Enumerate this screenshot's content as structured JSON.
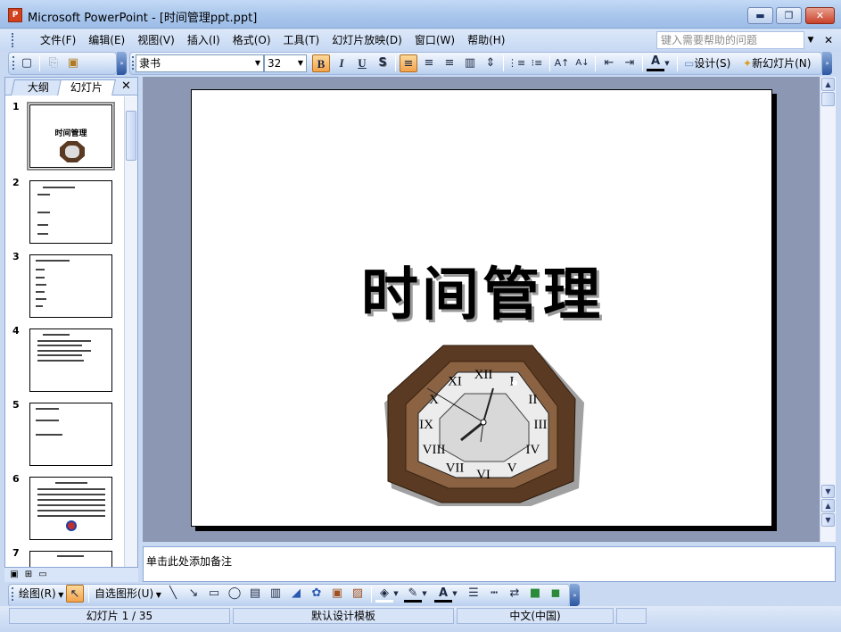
{
  "window": {
    "title": "Microsoft PowerPoint - [时间管理ppt.ppt]",
    "app_icon_text": "P",
    "min_glyph": "▬",
    "max_glyph": "❐",
    "close_glyph": "✕"
  },
  "menubar": {
    "items": [
      "文件(F)",
      "编辑(E)",
      "视图(V)",
      "插入(I)",
      "格式(O)",
      "工具(T)",
      "幻灯片放映(D)",
      "窗口(W)",
      "帮助(H)"
    ],
    "help_placeholder": "键入需要帮助的问题",
    "help_arrow": "▼",
    "close_glyph": "✕"
  },
  "toolbar": {
    "font": "隶书",
    "size": "32",
    "dropdown_arrow": "▼",
    "bold": "B",
    "italic": "I",
    "underline": "U",
    "shadow": "S",
    "align_left": "≡",
    "align_center": "≡",
    "align_right": "≡",
    "distribute": "▥",
    "column": "⇕",
    "numbering": "⋮≡",
    "bullets": "⁝≡",
    "grow": "A↑",
    "shrink": "A↓",
    "decrease_indent": "⇤",
    "increase_indent": "⇥",
    "font_color": "A",
    "design_label": "设计(S)",
    "new_slide_label": "新幻灯片(N)",
    "new_glyph": "▢",
    "copy_glyph": "⎘",
    "paste_glyph": "▣",
    "more_glyph": "»"
  },
  "left_pane": {
    "tab_outline": "大纲",
    "tab_slides": "幻灯片",
    "close_glyph": "✕",
    "slide_numbers": [
      "1",
      "2",
      "3",
      "4",
      "5",
      "6",
      "7"
    ],
    "view_normal": "▣",
    "view_sorter": "⊞",
    "view_show": "▭"
  },
  "slide": {
    "title": "时间管理",
    "clock_numerals": [
      "XII",
      "I",
      "II",
      "III",
      "IV",
      "V",
      "VI",
      "VII",
      "VIII",
      "IX",
      "X",
      "XI"
    ]
  },
  "notes": {
    "placeholder": "单击此处添加备注"
  },
  "drawbar": {
    "draw_label": "绘图(R)",
    "autoshapes_label": "自选图形(U)"
  },
  "status": {
    "slide_info": "幻灯片 1 / 35",
    "template": "默认设计模板",
    "language": "中文(中国)"
  },
  "colors": {
    "frame": "#c9d9f2",
    "workspace": "#8c97b3",
    "clock_wood_dark": "#5a3a22",
    "clock_wood_light": "#8b6242",
    "clock_face": "#d8d8d8"
  }
}
